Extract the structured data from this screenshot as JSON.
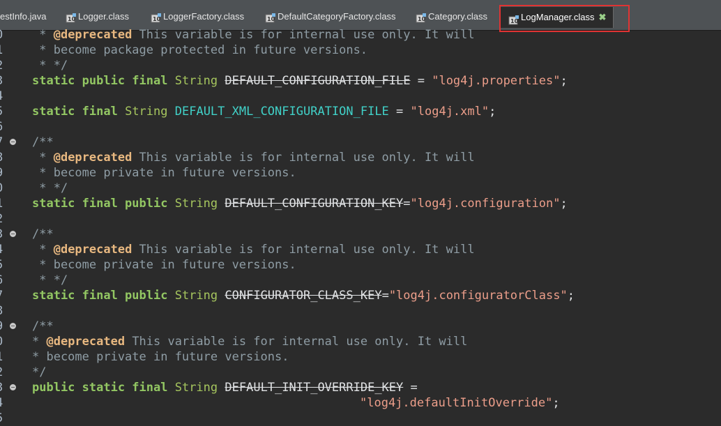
{
  "tabs": [
    {
      "label": "estInfo.java",
      "icon": "java-file-icon"
    },
    {
      "label": "Logger.class",
      "icon": "class-file-icon"
    },
    {
      "label": "LoggerFactory.class",
      "icon": "class-file-icon"
    },
    {
      "label": "DefaultCategoryFactory.class",
      "icon": "class-file-icon"
    },
    {
      "label": "Category.class",
      "icon": "class-file-icon"
    },
    {
      "label": "LogManager.class",
      "icon": "class-file-icon",
      "active": true,
      "close": "✖"
    }
  ],
  "gutter": [
    "0",
    "1",
    "2",
    "3",
    "4",
    "5",
    "6",
    "7",
    "8",
    "9",
    "0",
    "1",
    "2",
    "3",
    "4",
    "5",
    "6",
    "7",
    "8",
    "9",
    "0",
    "1",
    "2",
    "3",
    "4",
    "5"
  ],
  "code": {
    "l0_a": " * ",
    "l0_tag": "@deprecated",
    "l0_b": " This variable is for internal use only. It will",
    "l1": " * become package protected in future versions.",
    "l2": " * */",
    "l3_k1": "static public final",
    "l3_t": "String",
    "l3_f": "DEFAULT_CONFIGURATION_FILE",
    "l3_eq": " = ",
    "l3_s": "\"log4j.properties\"",
    "l3_end": ";",
    "l5_k1": "static final",
    "l5_t": "String",
    "l5_f": "DEFAULT_XML_CONFIGURATION_FILE",
    "l5_eq": " = ",
    "l5_s": "\"log4j.xml\"",
    "l5_end": ";",
    "l7": "/**",
    "l8_a": " * ",
    "l8_tag": "@deprecated",
    "l8_b": " This variable is for internal use only. It will",
    "l9": " * become private in future versions.",
    "l10": " * */",
    "l11_k1": "static final public",
    "l11_t": "String",
    "l11_f": "DEFAULT_CONFIGURATION_KEY",
    "l11_eq": "=",
    "l11_s": "\"log4j.configuration\"",
    "l11_end": ";",
    "l13": "/**",
    "l14_a": " * ",
    "l14_tag": "@deprecated",
    "l14_b": " This variable is for internal use only. It will",
    "l15": " * become private in future versions.",
    "l16": " * */",
    "l17_k1": "static final public",
    "l17_t": "String",
    "l17_f": "CONFIGURATOR_CLASS_KEY",
    "l17_eq": "=",
    "l17_s": "\"log4j.configuratorClass\"",
    "l17_end": ";",
    "l19": "/**",
    "l20_a": "* ",
    "l20_tag": "@deprecated",
    "l20_b": " This variable is for internal use only. It will",
    "l21": "* become private in future versions.",
    "l22": "*/",
    "l23_k1": "public static final",
    "l23_t": "String",
    "l23_f": "DEFAULT_INIT_OVERRIDE_KEY",
    "l23_eq": " =",
    "l24_s": "\"log4j.defaultInitOverride\"",
    "l24_end": ";"
  }
}
